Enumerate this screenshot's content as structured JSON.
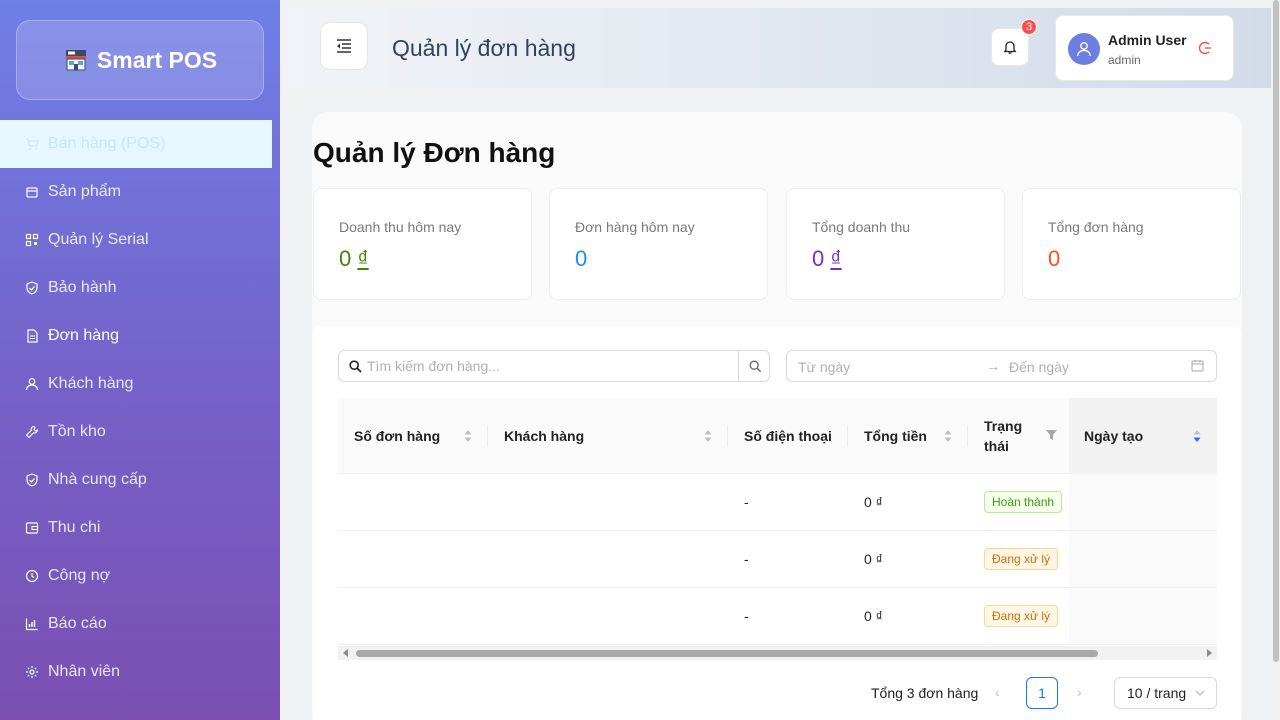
{
  "app": {
    "logo_text": "Smart POS"
  },
  "sidebar": {
    "items": [
      {
        "label": "Bán hàng (POS)",
        "icon": "cart-icon"
      },
      {
        "label": "Sản phẩm",
        "icon": "box-icon"
      },
      {
        "label": "Quản lý Serial",
        "icon": "qrcode-icon"
      },
      {
        "label": "Bảo hành",
        "icon": "shield-check-icon"
      },
      {
        "label": "Đơn hàng",
        "icon": "file-text-icon"
      },
      {
        "label": "Khách hàng",
        "icon": "user-icon"
      },
      {
        "label": "Tồn kho",
        "icon": "wrench-icon"
      },
      {
        "label": "Nhà cung cấp",
        "icon": "shield-check-icon"
      },
      {
        "label": "Thu chi",
        "icon": "wallet-icon"
      },
      {
        "label": "Công nợ",
        "icon": "clock-icon"
      },
      {
        "label": "Báo cáo",
        "icon": "bar-chart-icon"
      },
      {
        "label": "Nhân viên",
        "icon": "gear-icon"
      }
    ]
  },
  "header": {
    "title": "Quản lý đơn hàng",
    "notification_count": "3",
    "user_name": "Admin User",
    "user_role": "admin"
  },
  "main": {
    "page_title": "Quản lý Đơn hàng",
    "stats": [
      {
        "label": "Doanh thu hôm nay",
        "value": "0",
        "currency": "₫",
        "color": "#3f8600"
      },
      {
        "label": "Đơn hàng hôm nay",
        "value": "0",
        "currency": "",
        "color": "#1890ff"
      },
      {
        "label": "Tổng doanh thu",
        "value": "0",
        "currency": "₫",
        "color": "#722ed1"
      },
      {
        "label": "Tổng đơn hàng",
        "value": "0",
        "currency": "",
        "color": "#fa541c"
      }
    ],
    "search": {
      "placeholder": "Tìm kiếm đơn hàng..."
    },
    "date_range": {
      "from_placeholder": "Từ ngày",
      "to_placeholder": "Đến ngày",
      "arrow": "→"
    },
    "table": {
      "columns": [
        "Số đơn hàng",
        "Khách hàng",
        "Số điện thoại",
        "Tổng tiền",
        "Trạng thái",
        "Ngày tạo"
      ],
      "rows": [
        {
          "order_no": "",
          "customer": "",
          "phone": "-",
          "total": "0 ₫",
          "status": "Hoàn thành",
          "created": ""
        },
        {
          "order_no": "",
          "customer": "",
          "phone": "-",
          "total": "0 ₫",
          "status": "Đang xử lý",
          "created": ""
        },
        {
          "order_no": "",
          "customer": "",
          "phone": "-",
          "total": "0 ₫",
          "status": "Đang xử lý",
          "created": ""
        }
      ]
    },
    "pagination": {
      "total_text": "Tổng 3 đơn hàng",
      "current_page": "1",
      "prev": "‹",
      "next": "›",
      "page_size": "10 / trang"
    }
  }
}
